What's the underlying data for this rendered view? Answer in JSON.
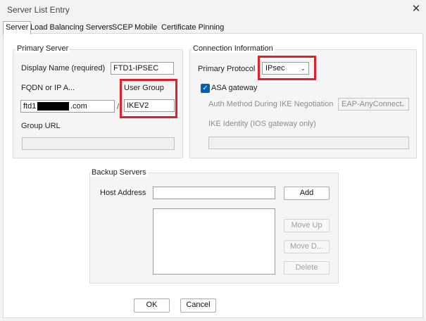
{
  "window": {
    "title": "Server List Entry",
    "close_glyph": "✕"
  },
  "tabs": [
    {
      "label": "Server",
      "active": true
    },
    {
      "label": "Load Balancing Servers"
    },
    {
      "label": "SCEP"
    },
    {
      "label": "Mobile"
    },
    {
      "label": "Certificate Pinning"
    }
  ],
  "primary_server": {
    "group_label": "Primary Server",
    "display_name_label": "Display Name (required)",
    "display_name_value": "FTD1-IPSEC",
    "fqdn_label": "FQDN or IP A...",
    "fqdn_value_prefix": "ftd1",
    "fqdn_value_suffix": ".com",
    "fqdn_separator": "/",
    "user_group_label": "User Group",
    "user_group_value": "IKEV2",
    "group_url_label": "Group URL",
    "group_url_value": ""
  },
  "connection_info": {
    "group_label": "Connection Information",
    "primary_protocol_label": "Primary Protocol",
    "primary_protocol_value": "IPsec",
    "asa_gateway_label": "ASA gateway",
    "asa_gateway_checked": true,
    "check_glyph": "✓",
    "auth_method_label": "Auth Method During IKE Negotiation",
    "auth_method_value": "EAP-AnyConnect",
    "ike_identity_label": "IKE Identity (IOS gateway only)",
    "ike_identity_value": ""
  },
  "backup_servers": {
    "group_label": "Backup Servers",
    "host_address_label": "Host Address",
    "host_address_value": "",
    "add_label": "Add",
    "move_up_label": "Move Up",
    "move_down_label": "Move D...",
    "delete_label": "Delete"
  },
  "footer": {
    "ok_label": "OK",
    "cancel_label": "Cancel"
  },
  "icons": {
    "dropdown": "chevron-down-icon",
    "close": "close-icon",
    "check": "check-icon"
  },
  "colors": {
    "highlight": "#e0202a",
    "checkbox_accent": "#005fb8"
  }
}
